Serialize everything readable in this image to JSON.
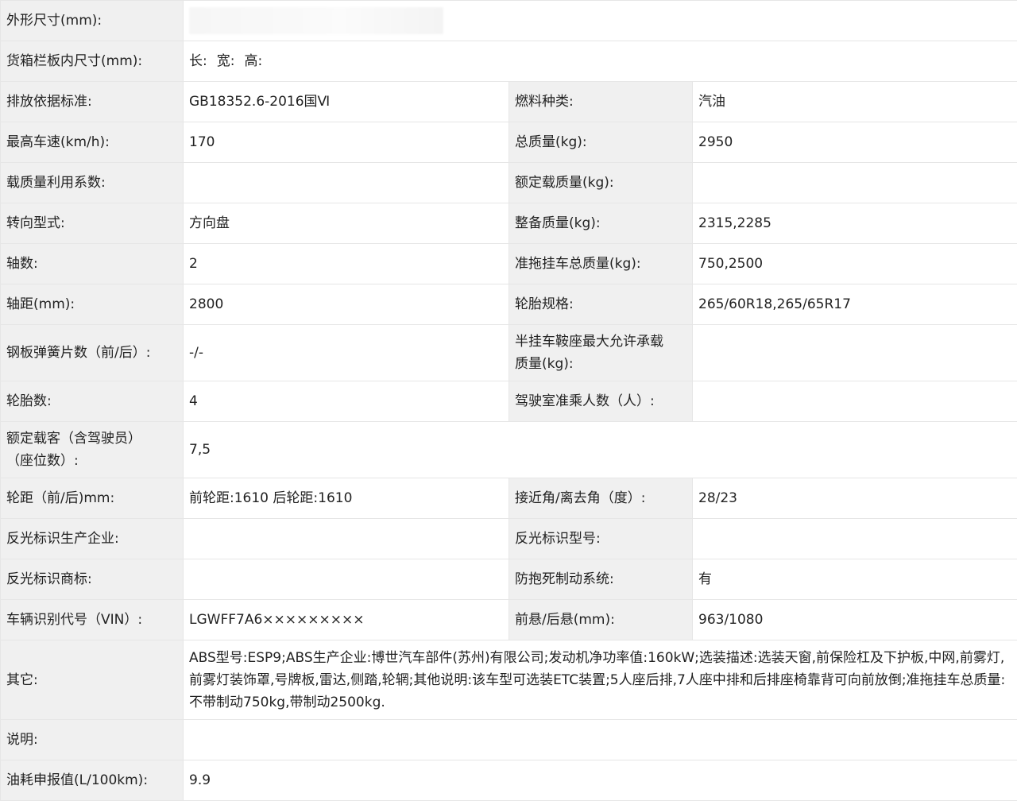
{
  "rows": {
    "outer_size_label": "外形尺寸(mm):",
    "cargo_size_label": "货箱栏板内尺寸(mm):",
    "cargo_len": "长:",
    "cargo_wid": "宽:",
    "cargo_hgt": "高:",
    "emission_label": "排放依据标准:",
    "emission_value": "GB18352.6-2016国Ⅵ",
    "fuel_label": "燃料种类:",
    "fuel_value": "汽油",
    "max_speed_label": "最高车速(km/h):",
    "max_speed_value": "170",
    "total_mass_label": "总质量(kg):",
    "total_mass_value": "2950",
    "load_util_label": "载质量利用系数:",
    "load_util_value": "",
    "rated_load_label": "额定载质量(kg):",
    "rated_load_value": "",
    "steering_label": "转向型式:",
    "steering_value": "方向盘",
    "curb_mass_label": "整备质量(kg):",
    "curb_mass_value": "2315,2285",
    "axles_label": "轴数:",
    "axles_value": "2",
    "towing_label": "准拖挂车总质量(kg):",
    "towing_value": "750,2500",
    "wheelbase_label": "轴距(mm):",
    "wheelbase_value": "2800",
    "tire_spec_label": "轮胎规格:",
    "tire_spec_value": "265/60R18,265/65R17",
    "leaf_spring_label": "钢板弹簧片数（前/后）:",
    "leaf_spring_value": "-/-",
    "saddle_label_1": "半挂车鞍座最大允许承载",
    "saddle_label_2": "质量(kg):",
    "saddle_value": "",
    "tire_count_label": "轮胎数:",
    "tire_count_value": "4",
    "cab_seats_label": "驾驶室准乘人数（人）:",
    "cab_seats_value": "",
    "passengers_label_1": "额定载客（含驾驶员）",
    "passengers_label_2": "（座位数）:",
    "passengers_value": "7,5",
    "track_label": "轮距（前/后)mm:",
    "track_value": "前轮距:1610 后轮距:1610",
    "angle_label": "接近角/离去角（度）:",
    "angle_value": "28/23",
    "reflect_maker_label": "反光标识生产企业:",
    "reflect_maker_value": "",
    "reflect_model_label": "反光标识型号:",
    "reflect_model_value": "",
    "reflect_brand_label": "反光标识商标:",
    "reflect_brand_value": "",
    "abs_label": "防抱死制动系统:",
    "abs_value": "有",
    "vin_label": "车辆识别代号（VIN）:",
    "vin_value": "LGWFF7A6×××××××××",
    "overhang_label": "前悬/后悬(mm):",
    "overhang_value": "963/1080",
    "other_label": "其它:",
    "other_value": "ABS型号:ESP9;ABS生产企业:博世汽车部件(苏州)有限公司;发动机净功率值:160kW;选装描述:选装天窗,前保险杠及下护板,中网,前雾灯,前雾灯装饰罩,号牌板,雷达,侧踏,轮辋;其他说明:该车型可选装ETC装置;5人座后排,7人座中排和后排座椅靠背可向前放倒;准拖挂车总质量:不带制动750kg,带制动2500kg.",
    "note_label": "说明:",
    "note_value": "",
    "fuel_cons_label": "油耗申报值(L/100km):",
    "fuel_cons_value": "9.9"
  }
}
